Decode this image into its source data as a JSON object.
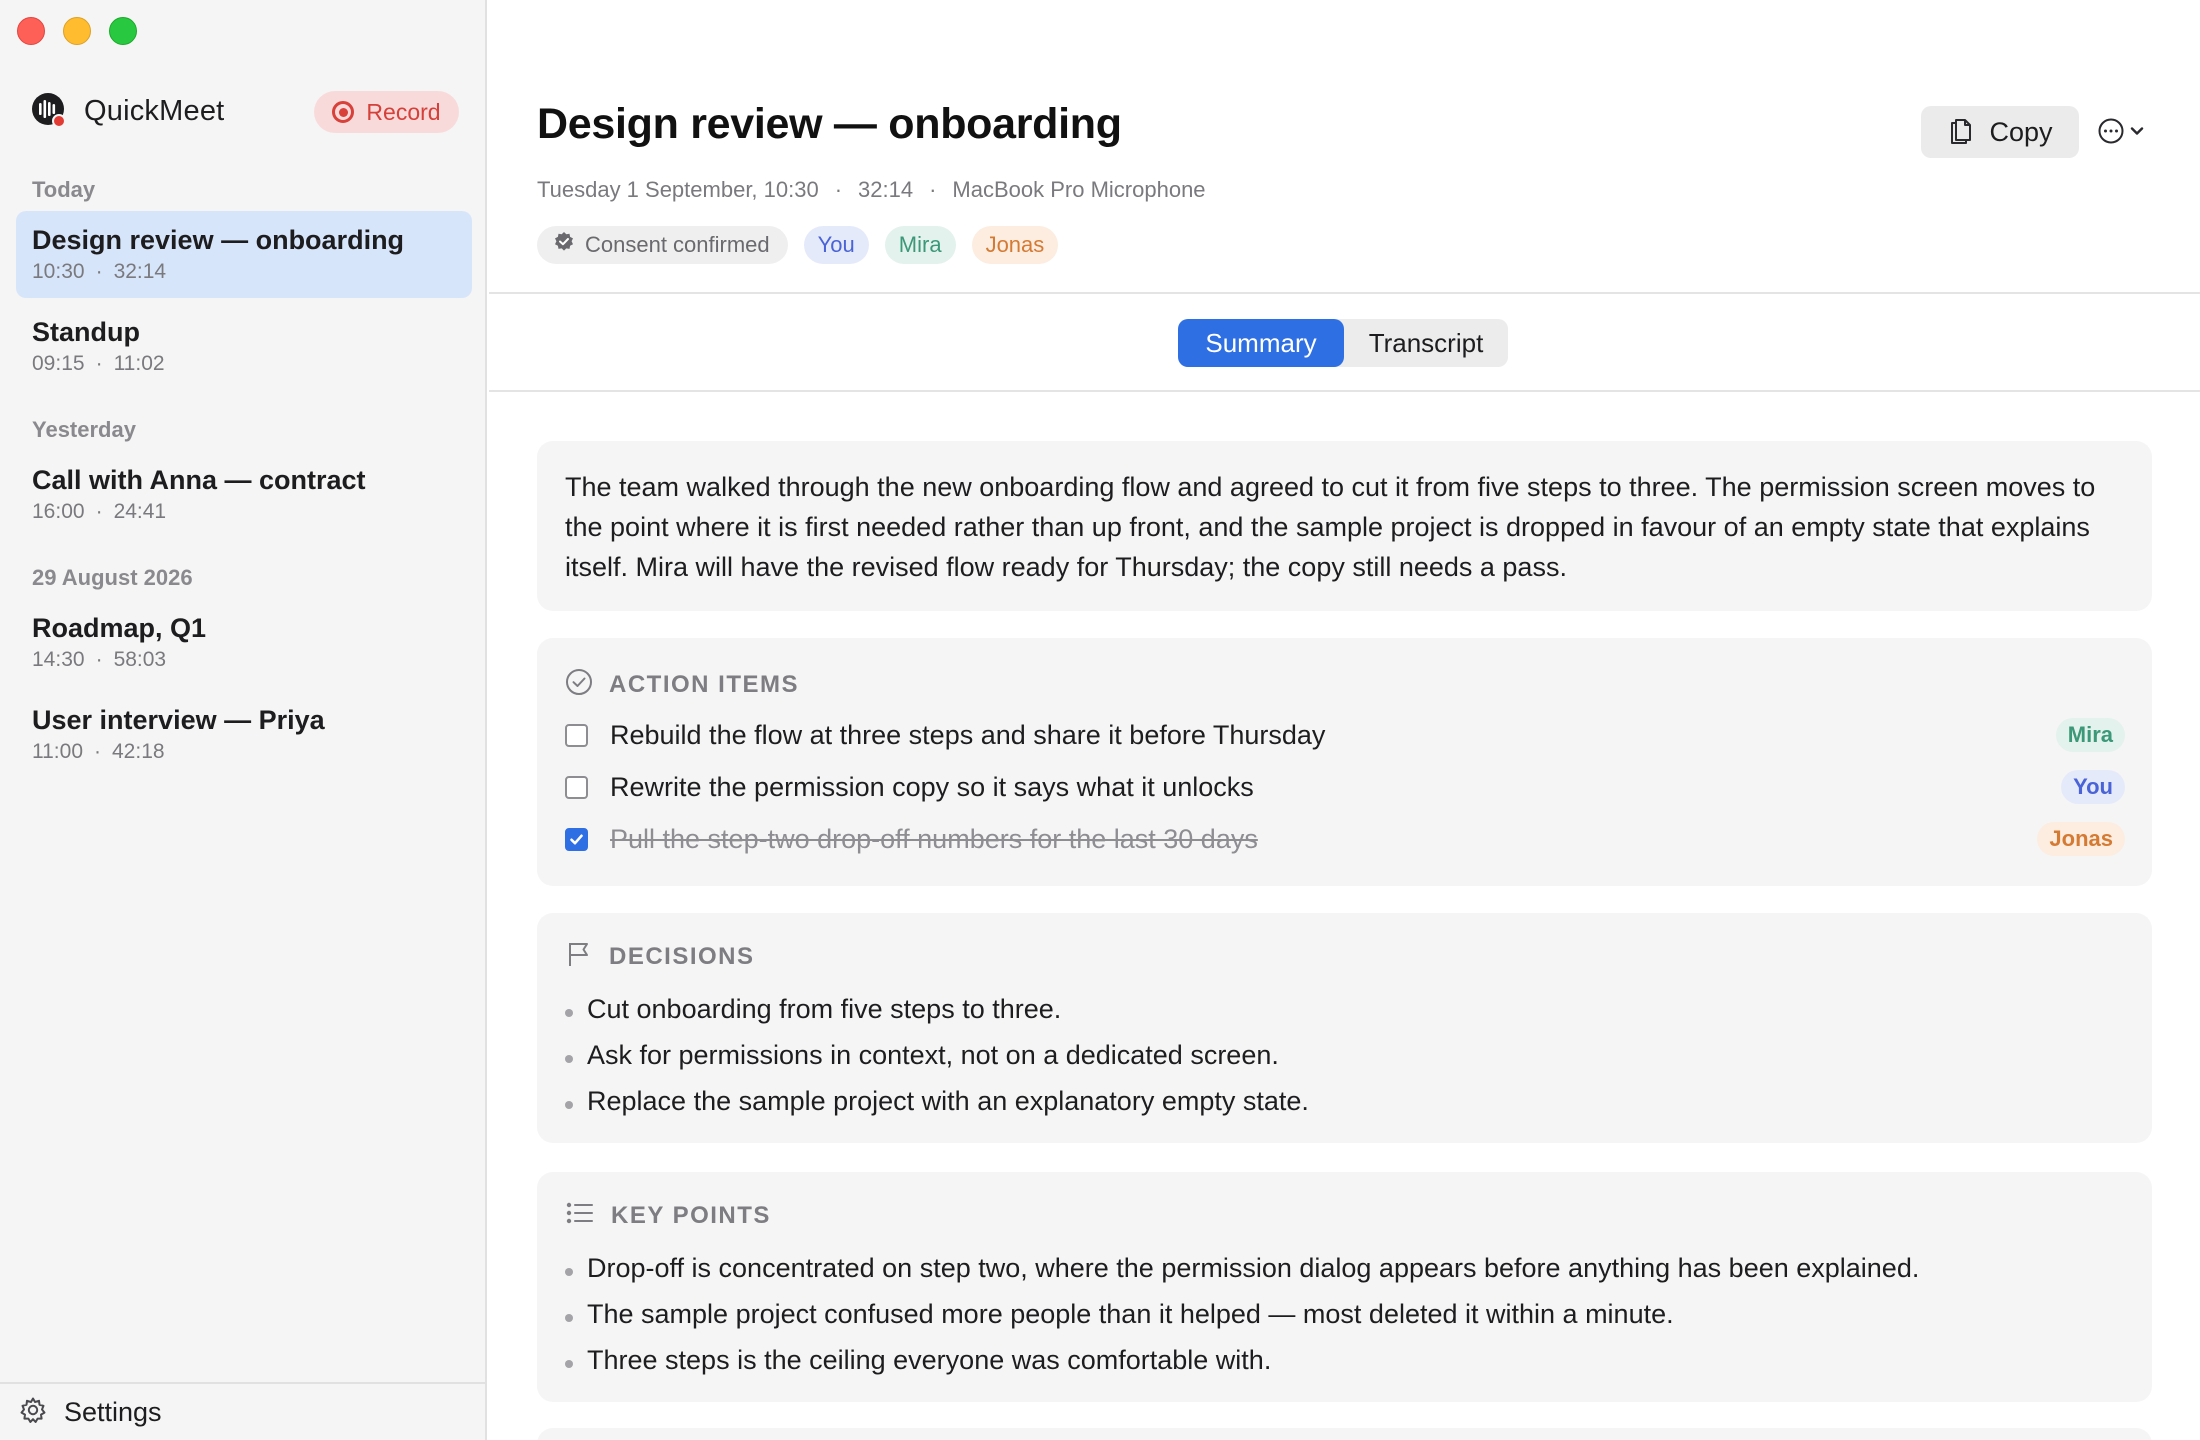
{
  "app": {
    "name": "QuickMeet",
    "record_label": "Record",
    "settings_label": "Settings"
  },
  "sidebar": {
    "sections": [
      {
        "label": "Today",
        "meetings": [
          {
            "title": "Design review — onboarding",
            "time": "10:30",
            "duration": "32:14",
            "active": true
          },
          {
            "title": "Standup",
            "time": "09:15",
            "duration": "11:02",
            "active": false
          }
        ]
      },
      {
        "label": "Yesterday",
        "meetings": [
          {
            "title": "Call with Anna — contract",
            "time": "16:00",
            "duration": "24:41",
            "active": false
          }
        ]
      },
      {
        "label": "29 August 2026",
        "meetings": [
          {
            "title": "Roadmap, Q1",
            "time": "14:30",
            "duration": "58:03",
            "active": false
          },
          {
            "title": "User interview — Priya",
            "time": "11:00",
            "duration": "42:18",
            "active": false
          }
        ]
      }
    ]
  },
  "meeting": {
    "title": "Design review — onboarding",
    "date": "Tuesday 1 September, 10:30",
    "duration": "32:14",
    "source": "MacBook Pro Microphone",
    "separator": "·",
    "consent_label": "Consent confirmed",
    "participants": [
      "You",
      "Mira",
      "Jonas"
    ],
    "copy_label": "Copy"
  },
  "tabs": {
    "summary": "Summary",
    "transcript": "Transcript"
  },
  "summary": {
    "text": "The team walked through the new onboarding flow and agreed to cut it from five steps to three. The permission screen moves to the point where it is first needed rather than up front, and the sample project is dropped in favour of an empty state that explains itself. Mira will have the revised flow ready for Thursday; the copy still needs a pass."
  },
  "action_items": {
    "header": "ACTION ITEMS",
    "items": [
      {
        "text": "Rebuild the flow at three steps and share it before Thursday",
        "owner": "Mira",
        "done": false
      },
      {
        "text": "Rewrite the permission copy so it says what it unlocks",
        "owner": "You",
        "done": false
      },
      {
        "text": "Pull the step-two drop-off numbers for the last 30 days",
        "owner": "Jonas",
        "done": true
      }
    ]
  },
  "decisions": {
    "header": "DECISIONS",
    "items": [
      "Cut onboarding from five steps to three.",
      "Ask for permissions in context, not on a dedicated screen.",
      "Replace the sample project with an explanatory empty state."
    ]
  },
  "key_points": {
    "header": "KEY POINTS",
    "items": [
      "Drop-off is concentrated on step two, where the permission dialog appears before anything has been explained.",
      "The sample project confused more people than it helped — most deleted it within a minute.",
      "Three steps is the ceiling everyone was comfortable with."
    ]
  },
  "colors": {
    "accent": "#2f6fe4",
    "record": "#d8403a",
    "you": "#4a63d6",
    "mira": "#3b9878",
    "jonas": "#d57a33"
  }
}
